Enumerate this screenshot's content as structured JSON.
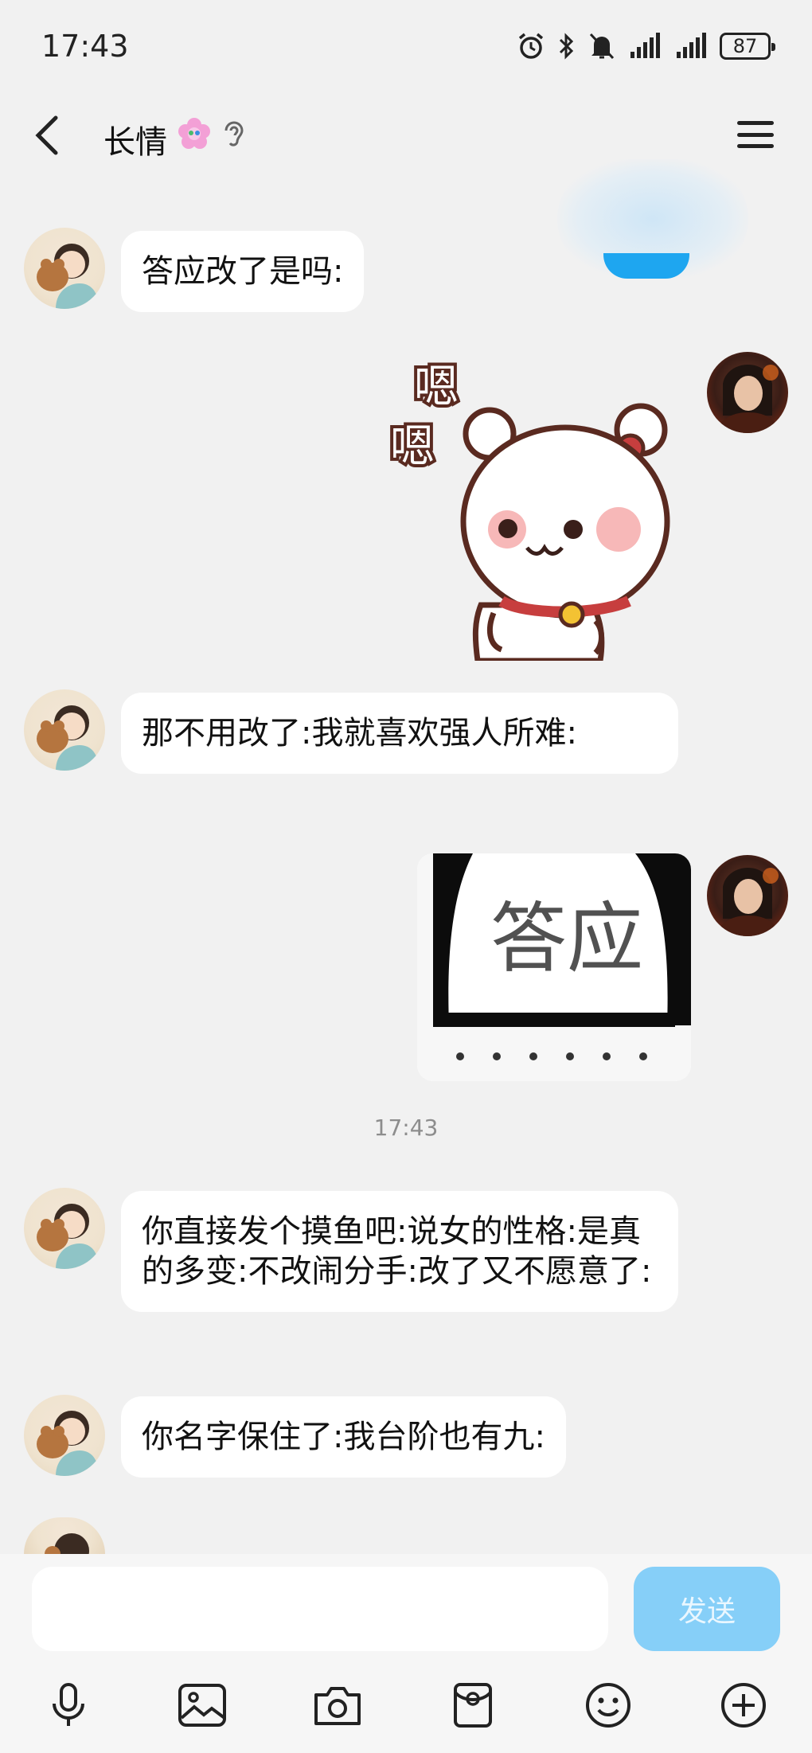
{
  "status_bar": {
    "time": "17:43",
    "battery": "87",
    "icons": [
      "alarm-icon",
      "bluetooth-icon",
      "mute-icon",
      "signal-icon",
      "signal-icon",
      "battery-icon"
    ]
  },
  "header": {
    "title": "长情",
    "icons": [
      "back-arrow-icon",
      "flower-badge-icon",
      "ear-icon",
      "menu-icon"
    ]
  },
  "messages": [
    {
      "side": "left",
      "text": "答应改了是吗:"
    },
    {
      "side": "right",
      "sticker": "bear-sticker",
      "sticker_text": "嗯\n嗯"
    },
    {
      "side": "left",
      "text": "那不用改了:我就喜欢强人所难:"
    },
    {
      "side": "right",
      "sticker": "panda-meme-sticker",
      "sticker_text": "答应"
    },
    {
      "timestamp": "17:43"
    },
    {
      "side": "left",
      "text": "你直接发个摸鱼吧:说女的性格:是真的多变:不改闹分手:改了又不愿意了:"
    },
    {
      "side": "left",
      "text": "你名字保住了:我台阶也有九:"
    }
  ],
  "composer": {
    "placeholder": "",
    "send_label": "发送",
    "tools": [
      "microphone-icon",
      "image-icon",
      "camera-icon",
      "red-packet-icon",
      "emoji-icon",
      "plus-icon"
    ]
  },
  "colors": {
    "background": "#f1f1f1",
    "bubble": "#ffffff",
    "send_button": "#86cff8",
    "accent": "#1ea6f0"
  }
}
